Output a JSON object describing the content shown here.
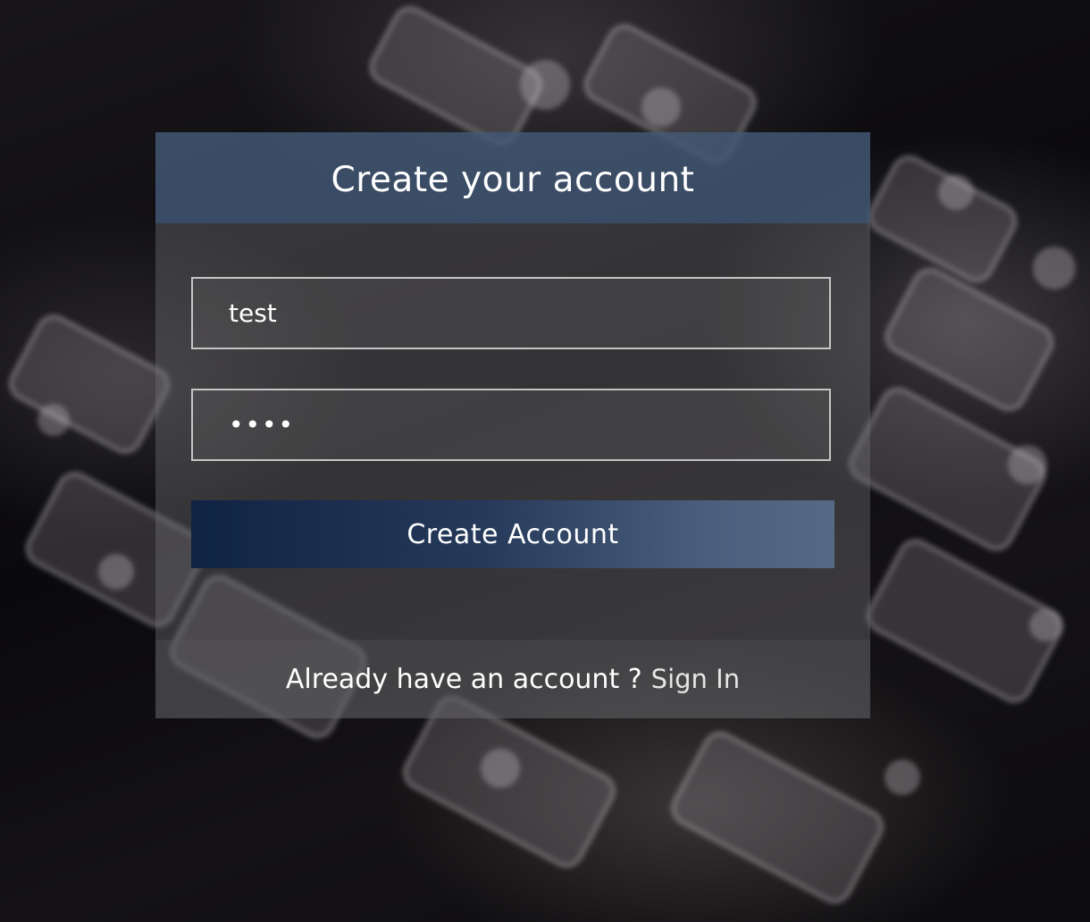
{
  "signup": {
    "title": "Create your account",
    "username_value": "test",
    "password_value": "test",
    "submit_label": "Create Account",
    "footer_prompt": "Already have an account ?",
    "signin_link": "Sign In"
  },
  "colors": {
    "header_bg": "#3c5476",
    "button_gradient_start": "#0f2444",
    "button_gradient_end": "#566a86",
    "card_overlay": "#6e6e70",
    "text": "#ffffff"
  }
}
